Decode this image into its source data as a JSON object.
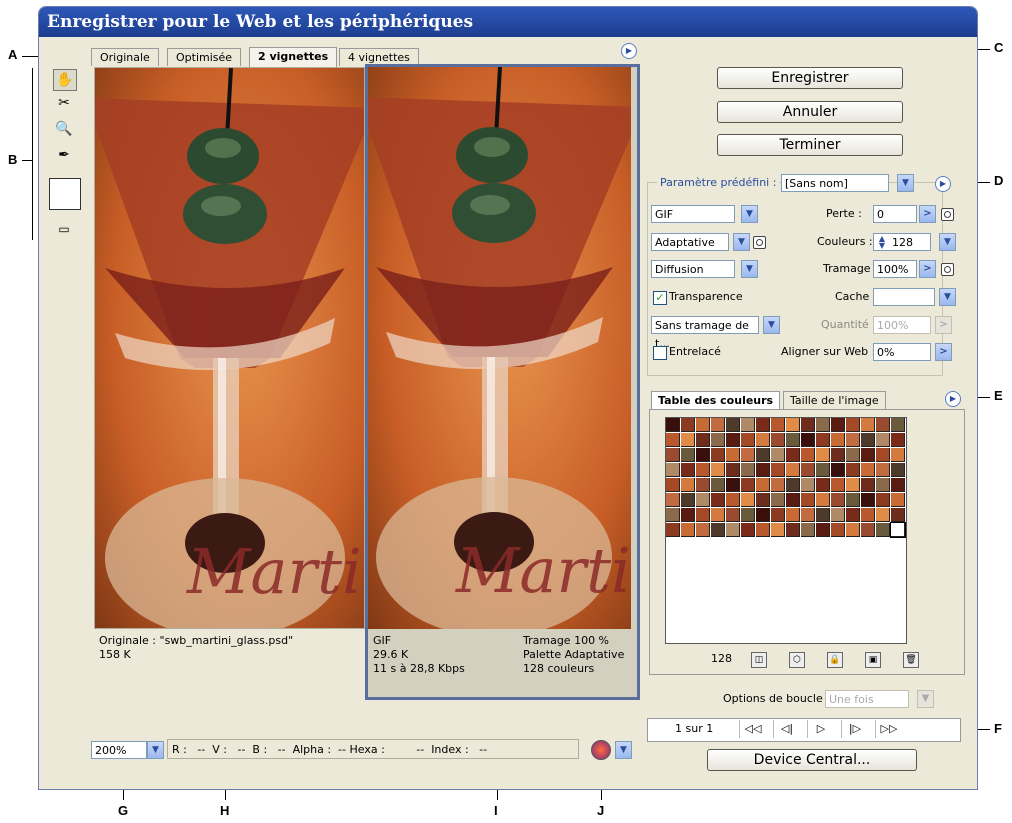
{
  "window": {
    "title": "Enregistrer pour le Web et les périphériques"
  },
  "view_tabs": [
    "Originale",
    "Optimisée",
    "2 vignettes",
    "4 vignettes"
  ],
  "actions": {
    "save": "Enregistrer",
    "cancel": "Annuler",
    "done": "Terminer",
    "device_central": "Device Central..."
  },
  "settings": {
    "preset_label": "Paramètre prédéfini :",
    "preset_value": "[Sans nom]",
    "format": "GIF",
    "reduction": "Adaptative",
    "dither_algo": "Diffusion",
    "transparency_label": "Transparence",
    "transparency_checked": true,
    "matte_dither": "Sans tramage de t...",
    "interlaced_label": "Entrelacé",
    "interlaced_checked": false,
    "lossy_label": "Perte :",
    "lossy_value": "0",
    "colors_label": "Couleurs :",
    "colors_value": "128",
    "dither_label": "Tramage :",
    "dither_value": "100%",
    "matte_label": "Cache :",
    "matte_value": "",
    "amount_label": "Quantité :",
    "amount_value": "100%",
    "web_snap_label": "Aligner sur Web :",
    "web_snap_value": "0%"
  },
  "color_table": {
    "tabs": [
      "Table des couleurs",
      "Taille de l'image"
    ],
    "count": "128",
    "icons": [
      "map-to-web-icon",
      "lock-cube-icon",
      "lock-icon",
      "new-color-icon",
      "trash-icon"
    ]
  },
  "looping": {
    "label": "Options de boucle :",
    "value": "Une fois"
  },
  "animation": {
    "frame_label": "1 sur 1",
    "buttons": [
      "◁◁",
      "◁|",
      "▷",
      "|▷",
      "▷▷"
    ]
  },
  "previews": {
    "original": {
      "line1": "Originale : \"swb_martini_glass.psd\"",
      "line2": "158 K",
      "image_text": "Marti"
    },
    "optimized": {
      "line1_left": "GIF",
      "line2_left": "29.6 K",
      "line3_left": "11 s à 28,8 Kbps",
      "line1_right": "Tramage 100 %",
      "line2_right": "Palette Adaptative",
      "line3_right": "128 couleurs",
      "image_text": "Marti"
    }
  },
  "status": {
    "zoom": "200%",
    "info": "R :   --  V :   --  B :   --  Alpha :  -- Hexa :         --  Index :   --"
  },
  "callouts": [
    "A",
    "B",
    "C",
    "D",
    "E",
    "F",
    "G",
    "H",
    "I",
    "J"
  ],
  "colors": {
    "title_bar": "#1f45a0",
    "panel_bg": "#ece9d8",
    "accent": "#2a4d9e"
  }
}
